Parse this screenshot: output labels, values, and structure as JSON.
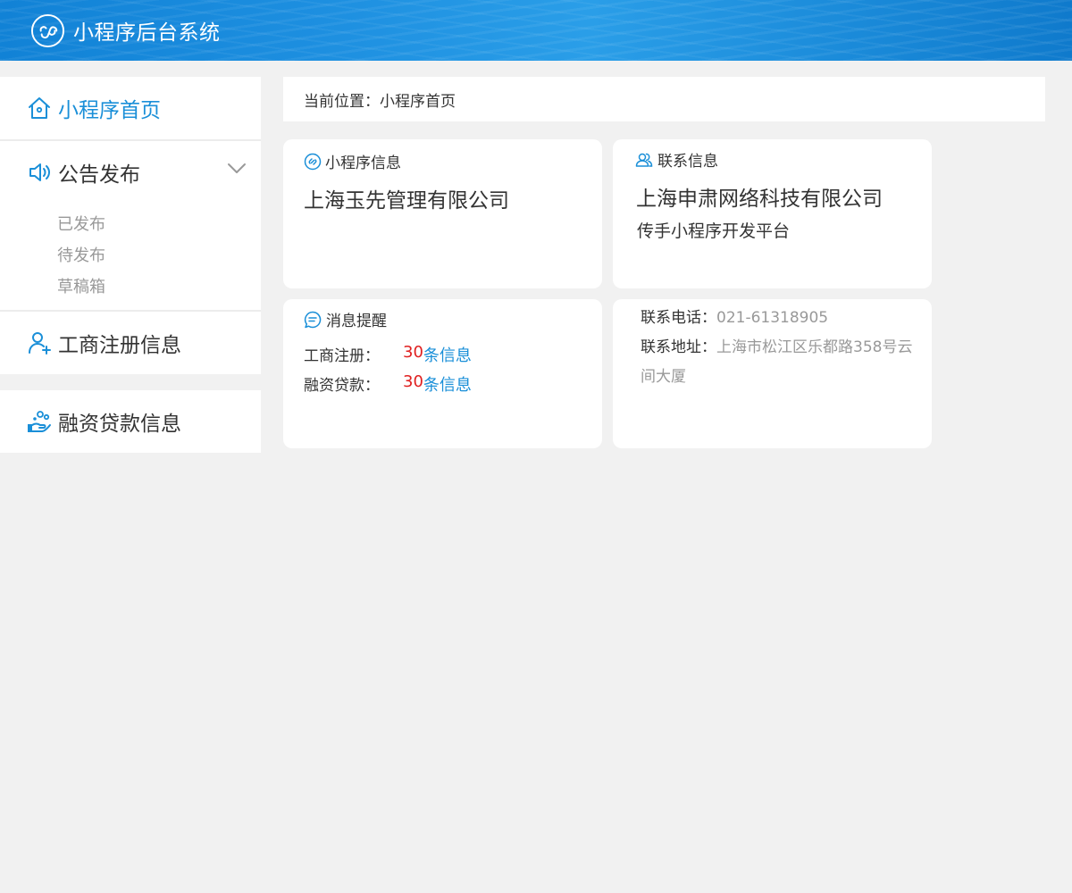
{
  "header": {
    "title": "小程序后台系统",
    "logo_icon": "miniprogram-logo-icon"
  },
  "sidebar": {
    "home": {
      "label": "小程序首页",
      "icon": "home-icon"
    },
    "announce": {
      "label": "公告发布",
      "icon": "speaker-icon",
      "expanded_icon": "chevron-down-icon",
      "sub_items": [
        {
          "label": "已发布"
        },
        {
          "label": "待发布"
        },
        {
          "label": "草稿箱"
        }
      ]
    },
    "registration": {
      "label": "工商注册信息",
      "icon": "user-add-icon"
    },
    "financing": {
      "label": "融资贷款信息",
      "icon": "hand-coins-icon"
    }
  },
  "breadcrumb": {
    "text": "当前位置：小程序首页"
  },
  "cards": {
    "miniprogram": {
      "title": "小程序信息",
      "icon": "link-icon",
      "company": "上海玉先管理有限公司"
    },
    "contact": {
      "title": "联系信息",
      "icon": "contacts-icon",
      "company": "上海申肃网络科技有限公司",
      "subtitle": "传手小程序开发平台"
    },
    "messages": {
      "title": "消息提醒",
      "icon": "message-icon",
      "rows": [
        {
          "key": "工商注册：",
          "count": "30",
          "unit": "条信息"
        },
        {
          "key": "融资贷款：",
          "count": "30",
          "unit": "条信息"
        }
      ]
    },
    "contact_detail": {
      "phone_label": "联系电话：",
      "phone": "021-61318905",
      "address_label": "联系地址：",
      "address": "上海市松江区乐都路358号云间大厦"
    }
  },
  "colors": {
    "accent": "#1a8fd8",
    "count_red": "#e02020",
    "muted": "#999999",
    "page_bg": "#f1f1f1"
  }
}
